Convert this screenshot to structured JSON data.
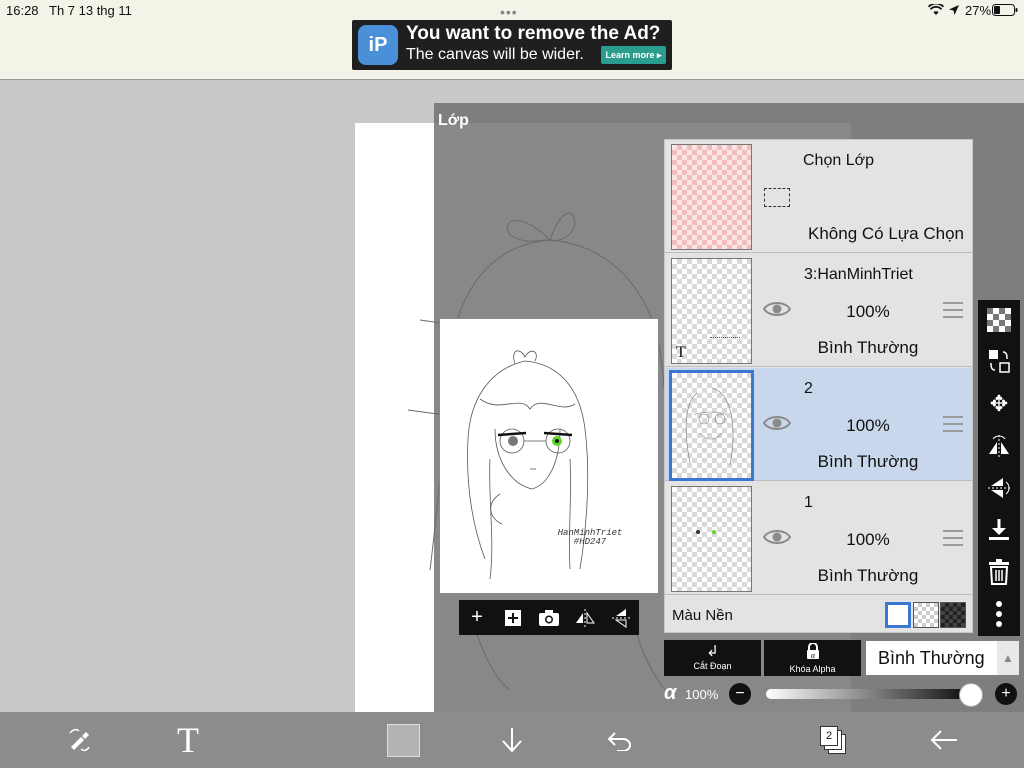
{
  "status_bar": {
    "time": "16:28",
    "date": "Th 7 13 thg 11",
    "battery": "27%",
    "icons": [
      "wifi-icon",
      "location-icon",
      "battery-icon"
    ]
  },
  "ad": {
    "title": "You want to remove the Ad?",
    "subtitle": "The canvas will be wider.",
    "button": "Learn more ▸",
    "logo_text": "iP"
  },
  "panel": {
    "title": "Lớp",
    "selection_row": {
      "name": "Chọn Lớp",
      "status": "Không Có Lựa Chọn"
    },
    "layers": [
      {
        "name": "3:HanMinhTriet",
        "opacity": "100%",
        "blend": "Bình Thường",
        "type_badge": "T",
        "selected": false
      },
      {
        "name": "2",
        "opacity": "100%",
        "blend": "Bình Thường",
        "selected": true
      },
      {
        "name": "1",
        "opacity": "100%",
        "blend": "Bình Thường",
        "selected": false
      }
    ],
    "background": {
      "label": "Màu Nền",
      "options": [
        "white",
        "transparent",
        "dark"
      ]
    },
    "clipping_button": "Cắt Đoạn",
    "alpha_lock_button": "Khóa Alpha",
    "blend_mode_value": "Bình Thường",
    "alpha_symbol": "α",
    "alpha_value": "100%",
    "alpha_level": 1.0
  },
  "preview": {
    "signature_line1": "HanMinhTriet",
    "signature_line2": "#HD247"
  },
  "right_tools": [
    "checkerboard-icon",
    "transform-layer-icon",
    "move-icon",
    "flip-horizontal-icon",
    "flip-vertical-icon",
    "merge-down-icon",
    "trash-icon",
    "more-icon"
  ],
  "preview_tools": [
    "add-layer-icon",
    "add-copy-icon",
    "camera-icon",
    "flip-h-icon",
    "flip-v-icon"
  ],
  "bottom_bar": {
    "layer_count": "2",
    "icons": [
      "brush-eraser-swap-icon",
      "text-icon",
      "color-swatch",
      "arrow-down-icon",
      "undo-icon",
      "layers-icon",
      "back-arrow-icon"
    ]
  },
  "colors": {
    "accent": "#3a78d4",
    "selected_row": "#c9d7ec",
    "panel_bg": "#e3e3e3",
    "bottom_bar": "#8c8c8c",
    "ad_button": "#2a9d8f"
  }
}
